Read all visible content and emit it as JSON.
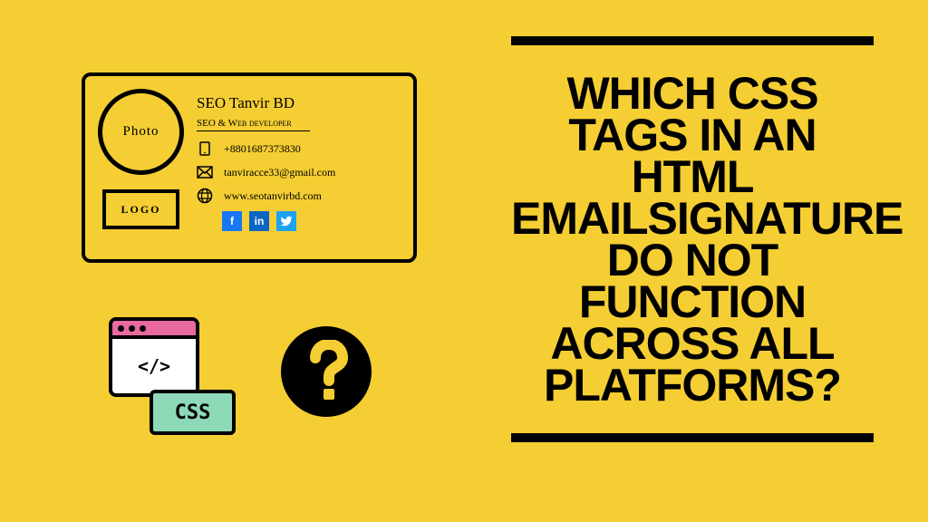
{
  "card": {
    "photo_label": "Photo",
    "logo_label": "LOGO",
    "name": "SEO Tanvir BD",
    "role": "SEO & Web developer",
    "phone": "+8801687373830",
    "email": "tanviracce33@gmail.com",
    "website": "www.seotanvirbd.com"
  },
  "illustration": {
    "code_tag": "</>",
    "css_label": "CSS"
  },
  "headline": "WHICH CSS TAGS IN AN HTML EMAILSIGNATURE DO NOT FUNCTION ACROSS ALL PLATFORMS?"
}
